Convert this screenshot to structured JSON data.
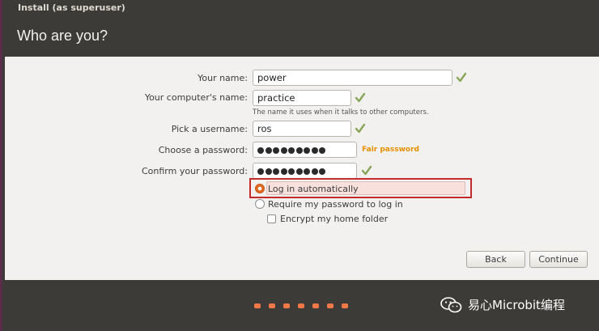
{
  "window": {
    "title": "Install (as superuser)"
  },
  "page": {
    "heading": "Who are you?"
  },
  "form": {
    "name_label": "Your name:",
    "name_value": "power",
    "computer_label": "Your computer's name:",
    "computer_value": "practice",
    "computer_hint": "The name it uses when it talks to other computers.",
    "username_label": "Pick a username:",
    "username_value": "ros",
    "password_label": "Choose a password:",
    "password_strength": "Fair password",
    "confirm_label": "Confirm your password:",
    "password_dot_count": 9
  },
  "login": {
    "auto_label": "Log in automatically",
    "require_label": "Require my password to log in",
    "encrypt_label": "Encrypt my home folder",
    "selected": "auto"
  },
  "buttons": {
    "back": "Back",
    "continue": "Continue"
  },
  "footer": {
    "watermark": "易心Microbit编程"
  },
  "colors": {
    "accent": "#e2691f",
    "check": "#87a556",
    "highlight_border": "#c42b2b"
  },
  "icons": {
    "valid": "check-icon",
    "watermark": "wechat-icon"
  }
}
